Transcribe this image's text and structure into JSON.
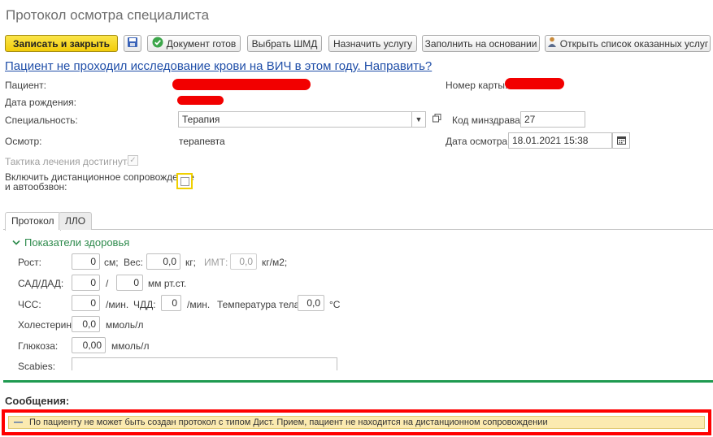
{
  "window": {
    "title": "Протокол осмотра специалиста"
  },
  "toolbar": {
    "save_close": "Записать и закрыть",
    "doc_ready": "Документ готов",
    "choose_shmd": "Выбрать ШМД",
    "assign_service": "Назначить услугу",
    "fill_based": "Заполнить на основании",
    "open_services": "Открыть список оказанных услуг"
  },
  "hiv_link": "Пациент не проходил исследование крови на ВИЧ в этом году. Направить?",
  "form": {
    "patient_label": "Пациент:",
    "card_number_label": "Номер карты:",
    "birth_date_label": "Дата рождения:",
    "specialty_label": "Специальность:",
    "specialty_value": "Терапия",
    "minzdrav_code_label": "Код минздрава:",
    "minzdrav_code_value": "27",
    "exam_label": "Осмотр:",
    "exam_value": "терапевта",
    "exam_date_label": "Дата осмотра:",
    "exam_date_value": "18.01.2021 15:38",
    "tactics_label": "Тактика лечения достигнута:",
    "remote_label_line1": "Включить дистанционное сопровождение",
    "remote_label_line2": "и автообзвон:"
  },
  "tabs": [
    {
      "label": "Протокол",
      "active": true
    },
    {
      "label": "ЛЛО",
      "active": false
    }
  ],
  "health": {
    "group_title": "Показатели здоровья",
    "height_label": "Рост:",
    "height_value": "0",
    "height_unit": "см;",
    "weight_label": "Вес:",
    "weight_value": "0,0",
    "weight_unit": "кг;",
    "bmi_label": "ИМТ:",
    "bmi_value": "0,0",
    "bmi_unit": "кг/м2;",
    "bp_label": "САД/ДАД:",
    "sad_value": "0",
    "bp_sep": "/",
    "dad_value": "0",
    "bp_unit": "мм рт.ст.",
    "hr_label": "ЧСС:",
    "hr_value": "0",
    "hr_unit": "/мин.",
    "rr_label": "ЧДД:",
    "rr_value": "0",
    "rr_unit": "/мин.",
    "temp_label": "Температура тела:",
    "temp_value": "0,0",
    "temp_unit": "°C",
    "chol_label": "Холестерин:",
    "chol_value": "0,0",
    "chol_unit": "ммоль/л",
    "gluc_label": "Глюкоза:",
    "gluc_value": "0,00",
    "gluc_unit": "ммоль/л",
    "scabies_label": "Scabies:"
  },
  "messages": {
    "title": "Сообщения:",
    "items": [
      "По пациенту не может быть создан протокол с типом Дист. Прием, пациент не находится на дистанционном сопровождении"
    ]
  },
  "colors": {
    "primary_button": "#f2cc0a",
    "link": "#1f4ea8",
    "group_title": "#2c8a4b",
    "separator": "#1f9a50",
    "message_highlight": "#ff0000",
    "message_bg": "#fbeab0"
  },
  "icons": [
    "save-icon",
    "check-circle-icon",
    "person-list-icon",
    "dropdown-arrow-icon",
    "open-form-icon",
    "calendar-icon",
    "chevron-down-icon"
  ]
}
